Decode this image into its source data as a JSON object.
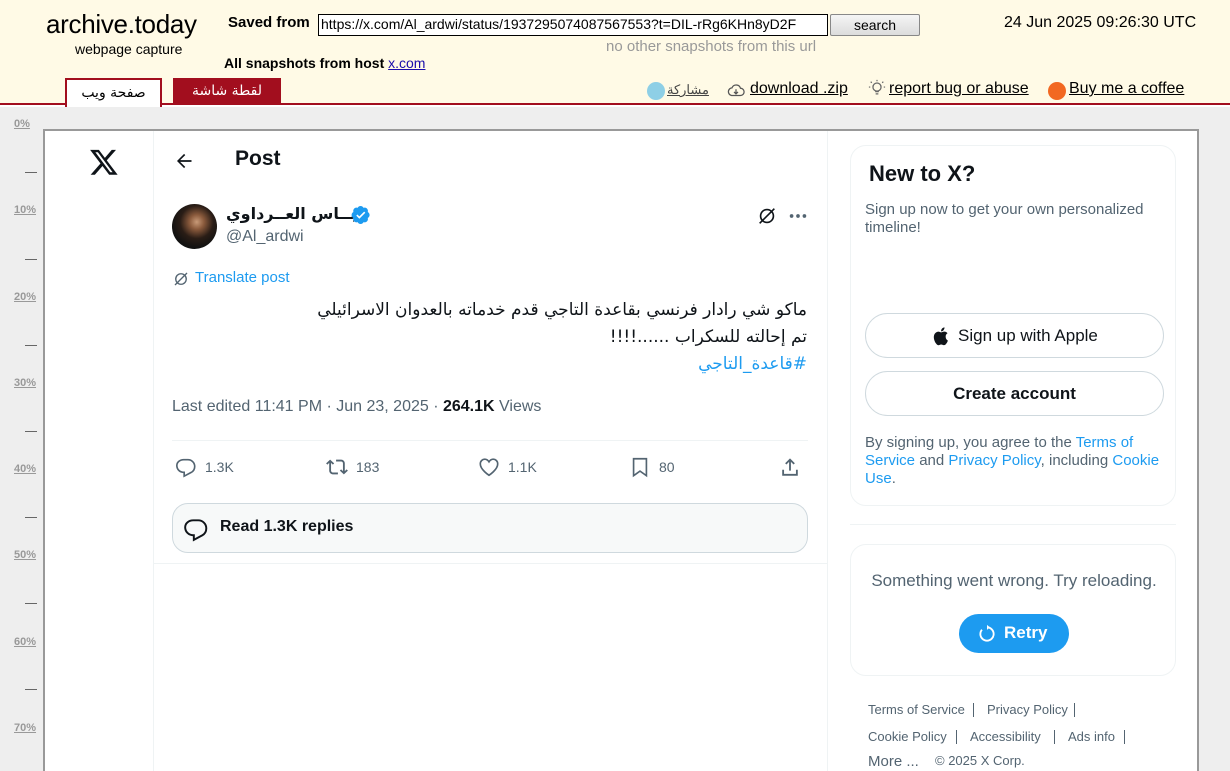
{
  "archive": {
    "logo_title": "archive.today",
    "logo_subtitle": "webpage capture",
    "saved_from_label": "Saved from",
    "url_value": "https://x.com/Al_ardwi/status/1937295074087567553?t=DIL-rRg6KHn8yD2F",
    "search_label": "search",
    "no_other": "no other snapshots from this url",
    "capture_date": "24 Jun 2025 09:26:30 UTC",
    "all_snapshots_label": "All snapshots  from host",
    "host_link": "x.com",
    "tab_webpage": "صفحة ويب",
    "tab_screenshot": "لقطة شاشة",
    "share_label": "مشاركة",
    "download_label": "download .zip",
    "report_label": "report bug or abuse",
    "coffee_label": "Buy me a coffee"
  },
  "ruler": {
    "labels": [
      "0%",
      "10%",
      "20%",
      "30%",
      "40%",
      "50%",
      "60%",
      "70%"
    ]
  },
  "x": {
    "post_heading": "Post",
    "author": {
      "display_name": "عبــاس العــرداوي",
      "handle": "@Al_ardwi"
    },
    "translate_label": "Translate post",
    "tweet": {
      "line1": "ماكو شي رادار فرنسي بقاعدة التاجي قدم خدماته بالعدوان الاسرائيلي",
      "line2": "تم إحالته للسكراب ......!!!!",
      "hashtag": "#قاعدة_التاجي"
    },
    "meta": {
      "edited": "Last edited 11:41 PM · Jun 23, 2025 · ",
      "views_count": "264.1K",
      "views_label": " Views"
    },
    "actions": {
      "replies": "1.3K",
      "reposts": "183",
      "likes": "1.1K",
      "bookmarks": "80"
    },
    "read_replies": "Read 1.3K replies"
  },
  "sidebar": {
    "new_title": "New to X?",
    "new_subtitle": "Sign up now to get your own personalized timeline!",
    "apple_button": "Sign up with Apple",
    "create_button": "Create account",
    "legal_prefix": "By signing up, you agree to the ",
    "terms_link": "Terms of Service",
    "legal_and": " and ",
    "privacy_link": "Privacy Policy",
    "legal_including": ", including ",
    "cookie_link": "Cookie Use",
    "legal_end": ".",
    "error_text": "Something went wrong. Try reloading.",
    "retry_label": "Retry",
    "footer": {
      "terms": "Terms of Service",
      "privacy": "Privacy Policy",
      "cookie": "Cookie Policy",
      "accessibility": "Accessibility",
      "ads": "Ads info",
      "more": "More ...",
      "copyright": "© 2025 X Corp."
    }
  },
  "colors": {
    "archive_bg": "#fffae6",
    "archive_red": "#a20e1e",
    "x_blue": "#1d9bf0",
    "x_text": "#0f1419",
    "x_muted": "#536471"
  }
}
